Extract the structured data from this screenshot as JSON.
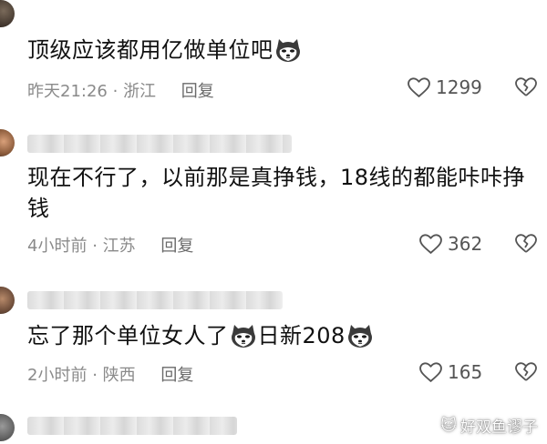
{
  "colors": {
    "text": "#111111",
    "meta": "#8a8a8a",
    "icon": "#555555"
  },
  "comments": [
    {
      "text": "顶级应该都用亿做单位吧",
      "time": "昨天21:26",
      "location": "浙江",
      "reply": "回复",
      "likes": "1299",
      "emoji": "husky-emoji"
    },
    {
      "text": "现在不行了，以前那是真挣钱，18线的都能咔咔挣钱",
      "time": "4小时前",
      "location": "江苏",
      "reply": "回复",
      "likes": "362"
    },
    {
      "text_before": "忘了那个单位女人了",
      "text_after": "日新208",
      "time": "2小时前",
      "location": "陕西",
      "reply": "回复",
      "likes": "165",
      "emoji": "husky-emoji"
    }
  ],
  "watermark": "好双鱼谬子"
}
